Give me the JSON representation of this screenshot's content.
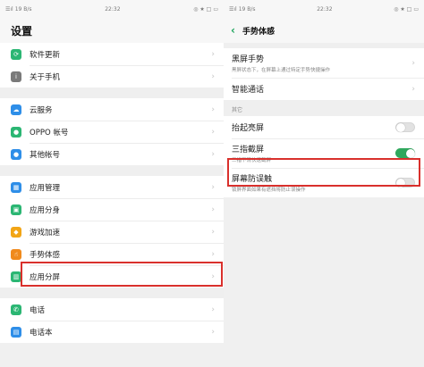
{
  "left": {
    "status": {
      "signal": "☰ıl",
      "network": "19 B/s",
      "time": "22:32",
      "icons": "◎ ★ □",
      "battery": "▭"
    },
    "title": "设置",
    "groups": [
      [
        {
          "label": "软件更新",
          "icon": "update-icon",
          "color": "#2bb673",
          "glyph": "⟳"
        },
        {
          "label": "关于手机",
          "icon": "info-icon",
          "color": "#7a7a7a",
          "glyph": "i"
        }
      ],
      [
        {
          "label": "云服务",
          "icon": "cloud-icon",
          "color": "#2e8ee8",
          "glyph": "☁"
        },
        {
          "label": "OPPO 帐号",
          "icon": "account-icon",
          "color": "#2bb673",
          "glyph": "●"
        },
        {
          "label": "其他帐号",
          "icon": "user-icon",
          "color": "#2e8ee8",
          "glyph": "●"
        }
      ],
      [
        {
          "label": "应用管理",
          "icon": "apps-grid-icon",
          "color": "#2e8ee8",
          "glyph": "▦"
        },
        {
          "label": "应用分身",
          "icon": "app-clone-icon",
          "color": "#2bb673",
          "glyph": "▣"
        },
        {
          "label": "游戏加速",
          "icon": "gamepad-icon",
          "color": "#f2a516",
          "glyph": "◆"
        },
        {
          "label": "手势体感",
          "icon": "gesture-hand-icon",
          "color": "#f08a1c",
          "glyph": "☝"
        },
        {
          "label": "应用分屏",
          "icon": "split-screen-icon",
          "color": "#2bb673",
          "glyph": "▥"
        }
      ],
      [
        {
          "label": "电话",
          "icon": "phone-icon",
          "color": "#2bb673",
          "glyph": "✆"
        },
        {
          "label": "电话本",
          "icon": "contacts-icon",
          "color": "#2e8ee8",
          "glyph": "▤"
        }
      ]
    ],
    "chevron": "›"
  },
  "right": {
    "status": {
      "signal": "☰ıl",
      "network": "19 B/s",
      "time": "22:32",
      "icons": "◎ ★ □",
      "battery": "▭"
    },
    "back": "‹",
    "title": "手势体感",
    "items_top": [
      {
        "title": "黑屏手势",
        "desc": "黑屏状态下，在屏幕上通过特定手势快捷操作"
      },
      {
        "title": "智能通话",
        "desc": ""
      }
    ],
    "section_label": "其它",
    "items_bottom": [
      {
        "title": "抬起亮屏",
        "desc": "",
        "state": "off"
      },
      {
        "title": "三指截屏",
        "desc": "三指下滑快速截屏",
        "state": "on"
      },
      {
        "title": "屏幕防误触",
        "desc": "锁屏界面如果有遮挡将防止误操作",
        "state": "off"
      }
    ],
    "chevron": "›"
  },
  "colors": {
    "accent_green": "#2fa85d",
    "highlight_red": "#d9302c"
  }
}
